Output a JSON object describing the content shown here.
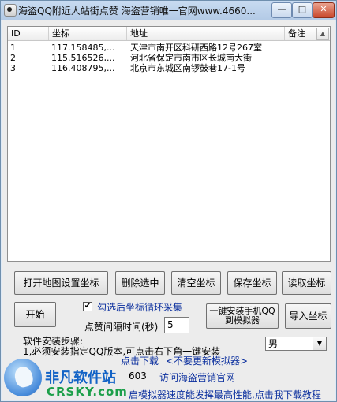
{
  "titlebar": {
    "title": "海盗QQ附近人站街点赞 海盗营销唯一官网www.4660...",
    "minimize": "—",
    "maximize": "□",
    "close": "✕"
  },
  "list": {
    "columns": [
      "ID",
      "坐标",
      "地址",
      "备注"
    ],
    "rows": [
      {
        "id": "1",
        "coord": "117.158485,...",
        "address": "天津市南开区科研西路12号267室",
        "note": ""
      },
      {
        "id": "2",
        "coord": "115.516526,...",
        "address": "河北省保定市南市区长城南大街",
        "note": ""
      },
      {
        "id": "3",
        "coord": "116.408795,...",
        "address": "北京市东城区南锣鼓巷17-1号",
        "note": ""
      }
    ]
  },
  "buttons": {
    "open_map": "打开地图设置坐标",
    "delete_selected": "删除选中",
    "clear_coords": "清空坐标",
    "save_coords": "保存坐标",
    "read_coords": "读取坐标",
    "start": "开始",
    "install_emulator": "一键安装手机QQ到模拟器",
    "import_coords": "导入坐标"
  },
  "options": {
    "loop_collect_checked": true,
    "loop_collect_label": "勾选后坐标循环采集",
    "interval_label": "点赞间隔时间(秒)",
    "interval_value": "5",
    "gender_value": "男"
  },
  "install": {
    "steps_title": "软件安装步骤:",
    "step1": "1,必须安装指定QQ版本,可点击右下角一键安装",
    "step2_link": "点击下载",
    "step2_link2": "<不要更新模拟器>",
    "number_fragment": "603",
    "official_site_link": "访问海盗营销官网",
    "bottom_hint": "启模拟器速度能发挥最高性能,点击我下载教程"
  },
  "watermark": {
    "title": "非凡软件站",
    "domain": "CRSKY.com"
  }
}
